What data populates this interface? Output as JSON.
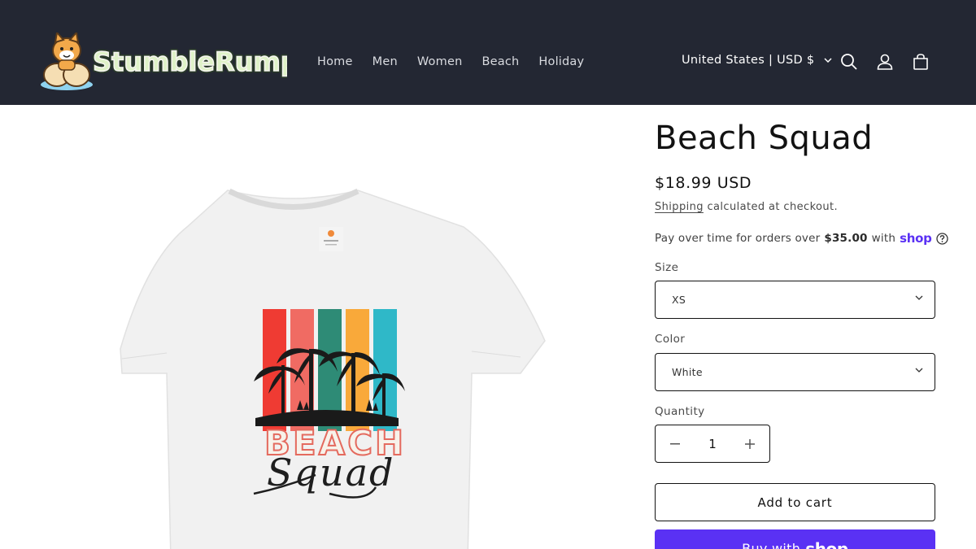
{
  "header": {
    "brand": "StumbleRump",
    "nav": [
      "Home",
      "Men",
      "Women",
      "Beach",
      "Holiday"
    ],
    "region": "United States | USD $",
    "icons": [
      "search-icon",
      "account-icon",
      "cart-icon"
    ],
    "background": "#232733"
  },
  "product": {
    "image_text": {
      "line1": "BEACH",
      "line2": "Squad"
    },
    "stripe_colors": [
      "#ef3b33",
      "#f06b63",
      "#2e8b76",
      "#f9a93a",
      "#2fb8c8"
    ],
    "title": "Beach Squad",
    "price": "$18.99 USD",
    "shipping_link": "Shipping",
    "shipping_rest": "calculated at checkout.",
    "installments": {
      "prefix": "Pay over time for orders over",
      "amount": "$35.00",
      "suffix": "with",
      "brand": "shop"
    },
    "size": {
      "label": "Size",
      "value": "XS"
    },
    "color": {
      "label": "Color",
      "value": "White"
    },
    "quantity": {
      "label": "Quantity",
      "value": "1"
    },
    "add_to_cart": "Add to cart",
    "buy_now": {
      "prefix": "Buy with",
      "brand": "shop"
    },
    "accent": "#5a31f4"
  }
}
